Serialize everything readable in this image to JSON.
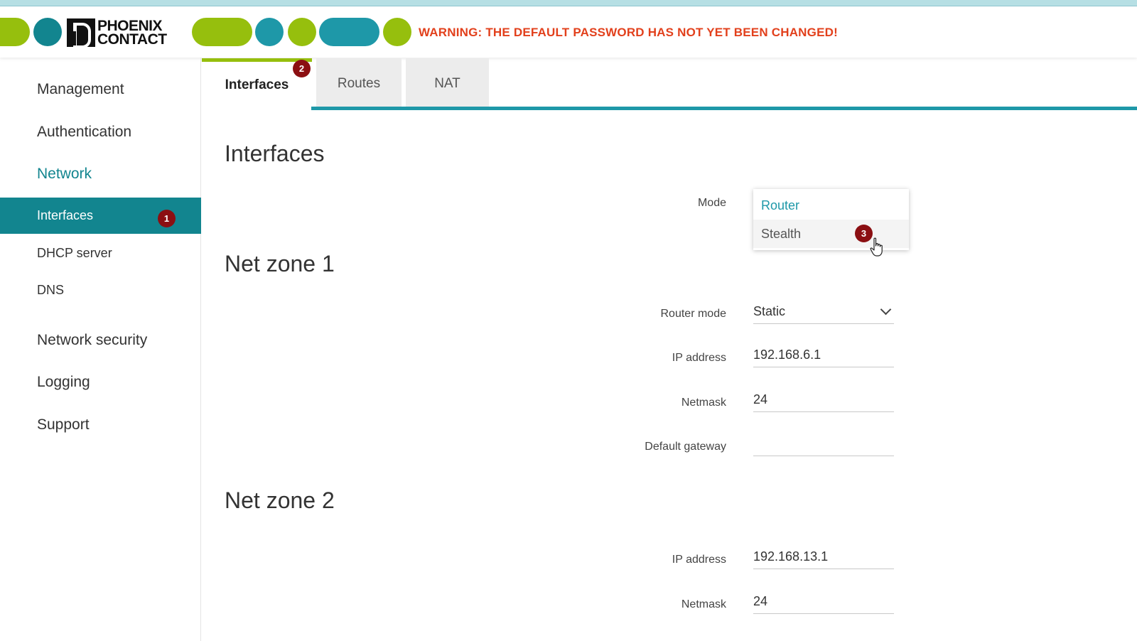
{
  "header": {
    "logo_line1": "PHOENIX",
    "logo_line2": "CONTACT",
    "warning": "WARNING: THE DEFAULT PASSWORD HAS NOT YET BEEN CHANGED!"
  },
  "sidebar": {
    "items": [
      {
        "label": "Management"
      },
      {
        "label": "Authentication"
      },
      {
        "label": "Network"
      },
      {
        "label": "Network security"
      },
      {
        "label": "Logging"
      },
      {
        "label": "Support"
      }
    ],
    "subitems": [
      {
        "label": "Interfaces",
        "badge": "1"
      },
      {
        "label": "DHCP server"
      },
      {
        "label": "DNS"
      }
    ]
  },
  "tabs": [
    {
      "label": "Interfaces",
      "badge": "2"
    },
    {
      "label": "Routes"
    },
    {
      "label": "NAT"
    }
  ],
  "main": {
    "title": "Interfaces",
    "mode": {
      "label": "Mode",
      "options": [
        {
          "label": "Router"
        },
        {
          "label": "Stealth",
          "badge": "3"
        }
      ]
    },
    "netzone1": {
      "title": "Net zone 1",
      "router_mode_label": "Router mode",
      "router_mode_value": "Static",
      "ip_label": "IP address",
      "ip_value": "192.168.6.1",
      "netmask_label": "Netmask",
      "netmask_value": "24",
      "gateway_label": "Default gateway",
      "gateway_value": ""
    },
    "netzone2": {
      "title": "Net zone 2",
      "ip_label": "IP address",
      "ip_value": "192.168.13.1",
      "netmask_label": "Netmask",
      "netmask_value": "24"
    }
  },
  "colors": {
    "brand_green": "#96bf0d",
    "brand_teal": "#1e98a8",
    "active_teal": "#12858f",
    "warning_red": "#e2401c",
    "badge_red": "#8b0f12"
  }
}
